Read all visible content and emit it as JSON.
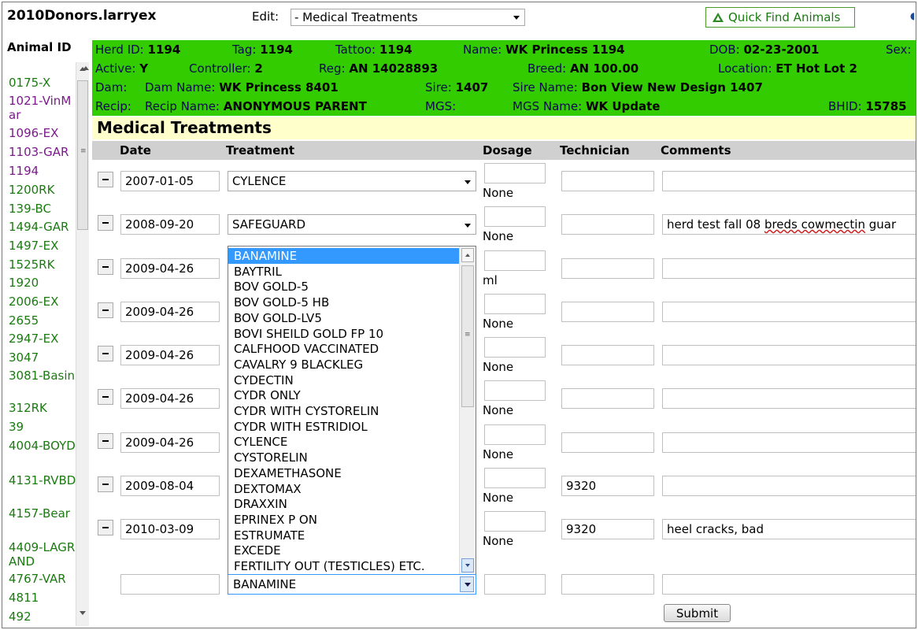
{
  "app": {
    "title": "2010Donors.larryex",
    "edit_label": "Edit:",
    "edit_value": "- Medical Treatments",
    "quick_find": "Quick Find Animals"
  },
  "sidebar": {
    "header": "Animal ID",
    "items": [
      {
        "label": "0175-X",
        "color": "green"
      },
      {
        "label": "1021-VinMar",
        "color": "purple"
      },
      {
        "label": "1096-EX",
        "color": "purple"
      },
      {
        "label": "1103-GAR",
        "color": "purple"
      },
      {
        "label": "1194",
        "color": "purple"
      },
      {
        "label": "1200RK",
        "color": "green"
      },
      {
        "label": "139-BC",
        "color": "green"
      },
      {
        "label": "1494-GAR",
        "color": "green"
      },
      {
        "label": "1497-EX",
        "color": "green"
      },
      {
        "label": "1525RK",
        "color": "green"
      },
      {
        "label": "1920",
        "color": "green"
      },
      {
        "label": "2006-EX",
        "color": "green"
      },
      {
        "label": "2655",
        "color": "green"
      },
      {
        "label": "2947-EX",
        "color": "green"
      },
      {
        "label": "3047",
        "color": "green"
      },
      {
        "label": "3081-Basin",
        "color": "green"
      },
      {
        "label": "312RK",
        "color": "green"
      },
      {
        "label": "39",
        "color": "green"
      },
      {
        "label": "4004-BOYD",
        "color": "green"
      },
      {
        "label": "4131-RVBD",
        "color": "green"
      },
      {
        "label": "4157-Bear",
        "color": "green"
      },
      {
        "label": "4409-LAGRAND",
        "color": "green"
      },
      {
        "label": "4767-VAR",
        "color": "green"
      },
      {
        "label": "4811",
        "color": "green"
      },
      {
        "label": "492",
        "color": "green"
      }
    ]
  },
  "animal": {
    "herd_id_label": "Herd ID:",
    "herd_id": "1194",
    "tag_label": "Tag:",
    "tag": "1194",
    "tattoo_label": "Tattoo:",
    "tattoo": "1194",
    "name_label": "Name:",
    "name": "WK Princess 1194",
    "dob_label": "DOB:",
    "dob": "02-23-2001",
    "sex_label": "Sex:",
    "active_label": "Active:",
    "active": "Y",
    "controller_label": "Controller:",
    "controller": "2",
    "reg_label": "Reg:",
    "reg": "AN 14028893",
    "breed_label": "Breed:",
    "breed": "AN 100.00",
    "location_label": "Location:",
    "location": "ET Hot Lot 2",
    "dam_label": "Dam:",
    "dam_name_label": "Dam Name:",
    "dam_name": "WK Princess 8401",
    "sire_label": "Sire:",
    "sire": "1407",
    "sire_name_label": "Sire Name:",
    "sire_name": "Bon View New Design 1407",
    "recip_label": "Recip:",
    "recip_name_label": "Recip Name:",
    "recip_name": "ANONYMOUS PARENT",
    "mgs_label": "MGS:",
    "mgs_name_label": "MGS Name:",
    "mgs_name": "WK Update",
    "bhid_label": "BHID:",
    "bhid": "15785"
  },
  "section": {
    "title": "Medical Treatments"
  },
  "columns": {
    "date": "Date",
    "treatment": "Treatment",
    "dosage": "Dosage",
    "technician": "Technician",
    "comments": "Comments"
  },
  "treatments": [
    {
      "date": "2007-01-05",
      "treatment": "CYLENCE",
      "dosage": "",
      "unit": "None",
      "technician": "",
      "comments": ""
    },
    {
      "date": "2008-09-20",
      "treatment": "SAFEGUARD",
      "dosage": "",
      "unit": "None",
      "technician": "",
      "comments_pre": "herd test fall 08 ",
      "comments_spell": "breds cowmectin",
      "comments_post": " guar"
    },
    {
      "date": "2009-04-26",
      "treatment": "",
      "dosage": "",
      "unit": "ml",
      "technician": "",
      "comments": ""
    },
    {
      "date": "2009-04-26",
      "treatment": "",
      "dosage": "",
      "unit": "None",
      "technician": "",
      "comments": ""
    },
    {
      "date": "2009-04-26",
      "treatment": "",
      "dosage": "",
      "unit": "None",
      "technician": "",
      "comments": ""
    },
    {
      "date": "2009-04-26",
      "treatment": "",
      "dosage": "",
      "unit": "None",
      "technician": "",
      "comments": ""
    },
    {
      "date": "2009-04-26",
      "treatment": "",
      "dosage": "",
      "unit": "None",
      "technician": "",
      "comments": ""
    },
    {
      "date": "2009-08-04",
      "treatment": "",
      "dosage": "",
      "unit": "None",
      "technician": "9320",
      "comments": ""
    },
    {
      "date": "2010-03-09",
      "treatment": "",
      "dosage": "",
      "unit": "None",
      "technician": "9320",
      "comments": "heel cracks, bad"
    }
  ],
  "listbox": {
    "options": [
      "BANAMINE",
      "BAYTRIL",
      "BOV GOLD-5",
      "BOV GOLD-5 HB",
      "BOV GOLD-LV5",
      "BOVI SHEILD GOLD FP 10",
      "CALFHOOD VACCINATED",
      "CAVALRY 9 BLACKLEG",
      "CYDECTIN",
      "CYDR ONLY",
      "CYDR WITH CYSTORELIN",
      "CYDR WITH ESTRIDIOL",
      "CYLENCE",
      "CYSTORELIN",
      "DEXAMETHASONE",
      "DEXTOMAX",
      "DRAXXIN",
      "EPRINEX P ON",
      "ESTRUMATE",
      "EXCEDE",
      "FERTILITY OUT (TESTICLES) ETC."
    ],
    "selected": "BANAMINE"
  },
  "new_row": {
    "treatment": "BANAMINE"
  },
  "submit_label": "Submit"
}
